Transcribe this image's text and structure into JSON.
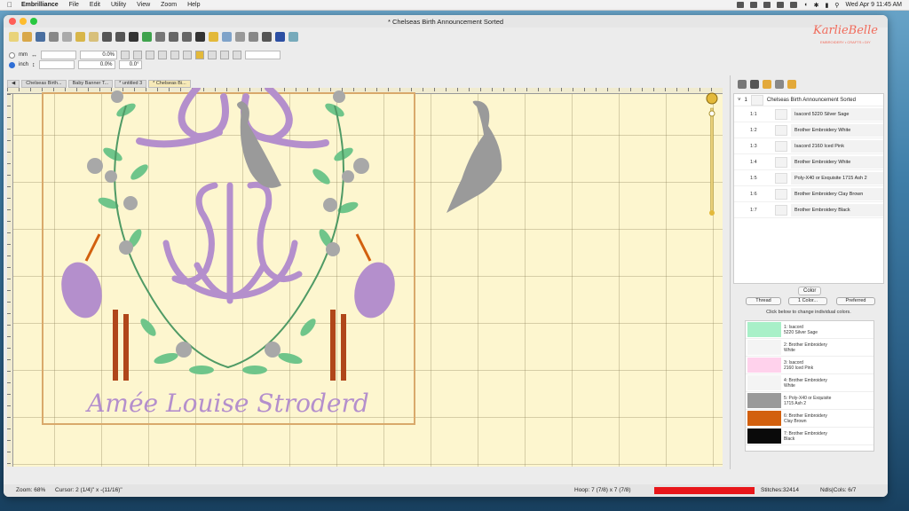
{
  "menubar": {
    "app_name": "Embrilliance",
    "menus": [
      "File",
      "Edit",
      "Utility",
      "View",
      "Zoom",
      "Help"
    ],
    "clock": "Wed Apr 9  11:45 AM"
  },
  "window": {
    "title": "* Chelseas Birth Announcement Sorted"
  },
  "toolbar": {
    "unit_mm": "mm",
    "unit_inch": "inch",
    "width_pct": "0.0%",
    "height_pct": "0.0%",
    "rotation": "0.0°"
  },
  "brand": {
    "logo_text": "KarlieBelle",
    "logo_sub": "EMBROIDERY • CRAFTS • DIY"
  },
  "tabs": [
    "Chelseas Birth...",
    "Baby Banner T...",
    "* untitled 3",
    "* Chelseas Bi..."
  ],
  "design": {
    "name_text": "Amée Louise Stroderd"
  },
  "statusbar": {
    "zoom": "Zoom: 68%",
    "cursor": "Cursor: 2 (1/4)\" x -(11/16)\"",
    "hoop": "Hoop: 7 (7/8) x 7 (7/8)",
    "stitches": "Stitches:32414",
    "ndls": "Ndls|Cols: 6/7"
  },
  "sequence": {
    "design_title": "Chelseas Birth Announcement Sorted",
    "design_index": "1",
    "rows": [
      {
        "num": "1:1",
        "name": "Isacord 5220 Silver Sage"
      },
      {
        "num": "1:2",
        "name": "Brother Embroidery White"
      },
      {
        "num": "1:3",
        "name": "Isacord 2160 Iced Pink"
      },
      {
        "num": "1:4",
        "name": "Brother Embroidery White"
      },
      {
        "num": "1:5",
        "name": "Poly-X40 or Exquisite 1715 Ash 2"
      },
      {
        "num": "1:6",
        "name": "Brother Embroidery Clay Brown"
      },
      {
        "num": "1:7",
        "name": "Brother Embroidery Black"
      }
    ]
  },
  "color_panel": {
    "label": "Color",
    "btn_thread": "Thread",
    "btn_one_color": "1 Color...",
    "btn_preferred": "Preferred",
    "hint": "Click below to change individual colors.",
    "colors": [
      {
        "label": "1: Isacord\n5220 Silver Sage",
        "hex": "#a8f0c8"
      },
      {
        "label": "2: Brother Embroidery\nWhite",
        "hex": "#f4f4f4"
      },
      {
        "label": "3: Isacord\n2160 Iced Pink",
        "hex": "#ffd2ec"
      },
      {
        "label": "4: Brother Embroidery\nWhite",
        "hex": "#f4f4f4"
      },
      {
        "label": "5: Poly-X40 or Exquisite\n1715 Ash 2",
        "hex": "#9a9a9a"
      },
      {
        "label": "6: Brother Embroidery\nClay Brown",
        "hex": "#d2600e"
      },
      {
        "label": "7: Brother Embroidery\nBlack",
        "hex": "#0a0a0a"
      }
    ]
  },
  "theme": {
    "canvas": "#fdf6cf",
    "hoop": "#d9a96b",
    "sage": "#6fc58a",
    "lilac": "#b48fcc",
    "grey": "#9a9a9a",
    "brown": "#b0461a",
    "status_red": "#e8161a"
  }
}
